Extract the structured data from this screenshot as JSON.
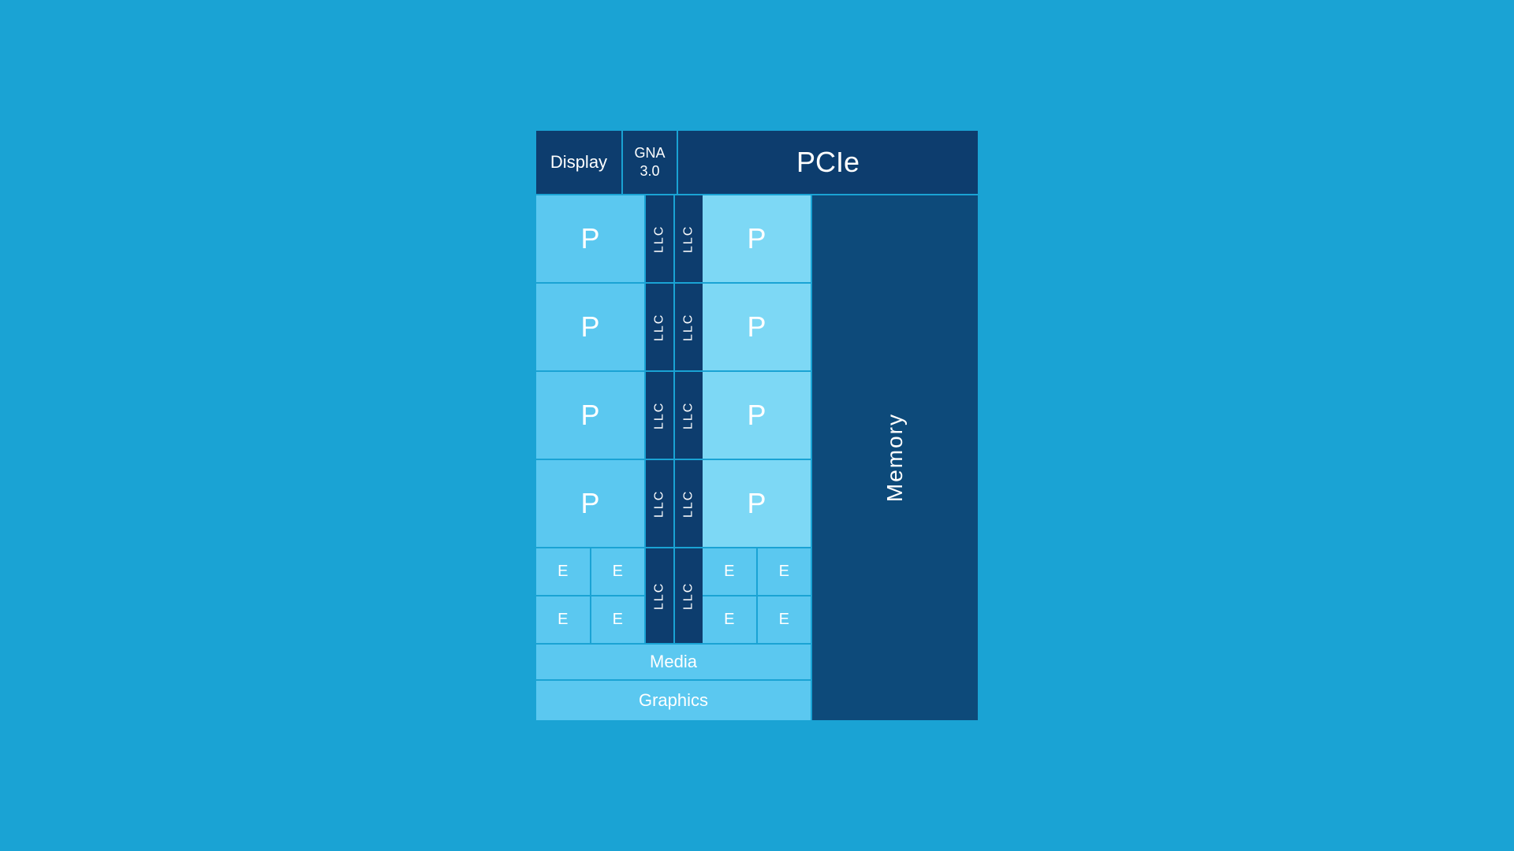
{
  "header": {
    "display_label": "Display",
    "gna_label": "GNA\n3.0",
    "pcie_label": "PCIe"
  },
  "cores": {
    "p_label": "P",
    "e_label": "E",
    "llc_label": "LLC",
    "media_label": "Media",
    "graphics_label": "Graphics",
    "memory_label": "Memory"
  },
  "colors": {
    "background": "#1aa3d4",
    "dark_navy": "#0d3d6e",
    "light_blue": "#5bc8f0",
    "lighter_blue": "#7dd8f5",
    "right_panel": "#0d4a7a"
  }
}
